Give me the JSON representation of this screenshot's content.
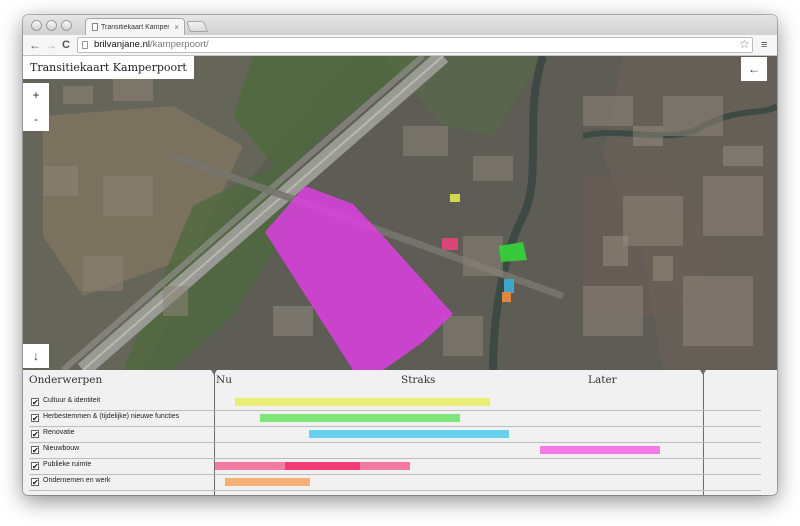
{
  "browser": {
    "tab_title": "Transitiekaart Kamperpoort",
    "tab_close": "×",
    "url_host": "brilvanjane.nl",
    "url_path": "/kamperpoort/",
    "back": "←",
    "forward": "→",
    "reload": "C",
    "star": "☆",
    "menu": "≡"
  },
  "map": {
    "title": "Transitiekaart Kamperpoort",
    "zoom_in": "+",
    "zoom_out": "-",
    "back_arrow": "←",
    "down_arrow": "↓"
  },
  "timeline": {
    "heading": "Onderwerpen",
    "phases": [
      "Nu",
      "Straks",
      "Later"
    ],
    "check_mark": "✔",
    "topics": [
      {
        "label": "Cultuur & identiteit",
        "color": "#e8ee74"
      },
      {
        "label": "Herbestemmen & (tijdelijke) nieuwe functies",
        "color": "#7fe67a"
      },
      {
        "label": "Renovatie",
        "color": "#66d2ee"
      },
      {
        "label": "Nieuwbouw",
        "color": "#f57ae8"
      },
      {
        "label": "Publieke ruimte",
        "color": "#f26a9a"
      },
      {
        "label": "Ondernemen en werk",
        "color": "#f5b076"
      }
    ]
  },
  "overlays": {
    "main_area_color": "#e23ee6",
    "pink_block_color": "#f0407e",
    "green_block_color": "#35d63a",
    "yellow_block_color": "#dbe74a",
    "blue_block_color": "#3aaed8",
    "orange_block_color": "#f28a3a"
  }
}
